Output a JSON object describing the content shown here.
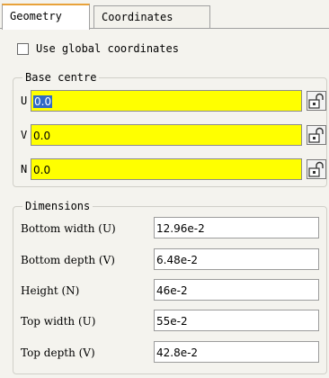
{
  "tabs": [
    {
      "label": "Geometry",
      "active": true
    },
    {
      "label": "Coordinates",
      "active": false
    }
  ],
  "use_global": {
    "label": "Use global coordinates",
    "checked": false
  },
  "base_centre": {
    "title": "Base centre",
    "rows": [
      {
        "label": "U",
        "value": "0.0",
        "selected": true
      },
      {
        "label": "V",
        "value": "0.0",
        "selected": false
      },
      {
        "label": "N",
        "value": "0.0",
        "selected": false
      }
    ]
  },
  "dimensions": {
    "title": "Dimensions",
    "rows": [
      {
        "label": "Bottom width (U)",
        "value": "12.96e-2"
      },
      {
        "label": "Bottom depth (V)",
        "value": "6.48e-2"
      },
      {
        "label": "Height (N)",
        "value": "46e-2"
      },
      {
        "label": "Top width (U)",
        "value": "55e-2"
      },
      {
        "label": "Top depth (V)",
        "value": "42.8e-2"
      }
    ]
  },
  "colors": {
    "field_highlight": "#ffff00",
    "selection": "#316ac5",
    "tab_accent": "#e8a23a"
  },
  "icons": {
    "lock": "padlock-icon"
  }
}
